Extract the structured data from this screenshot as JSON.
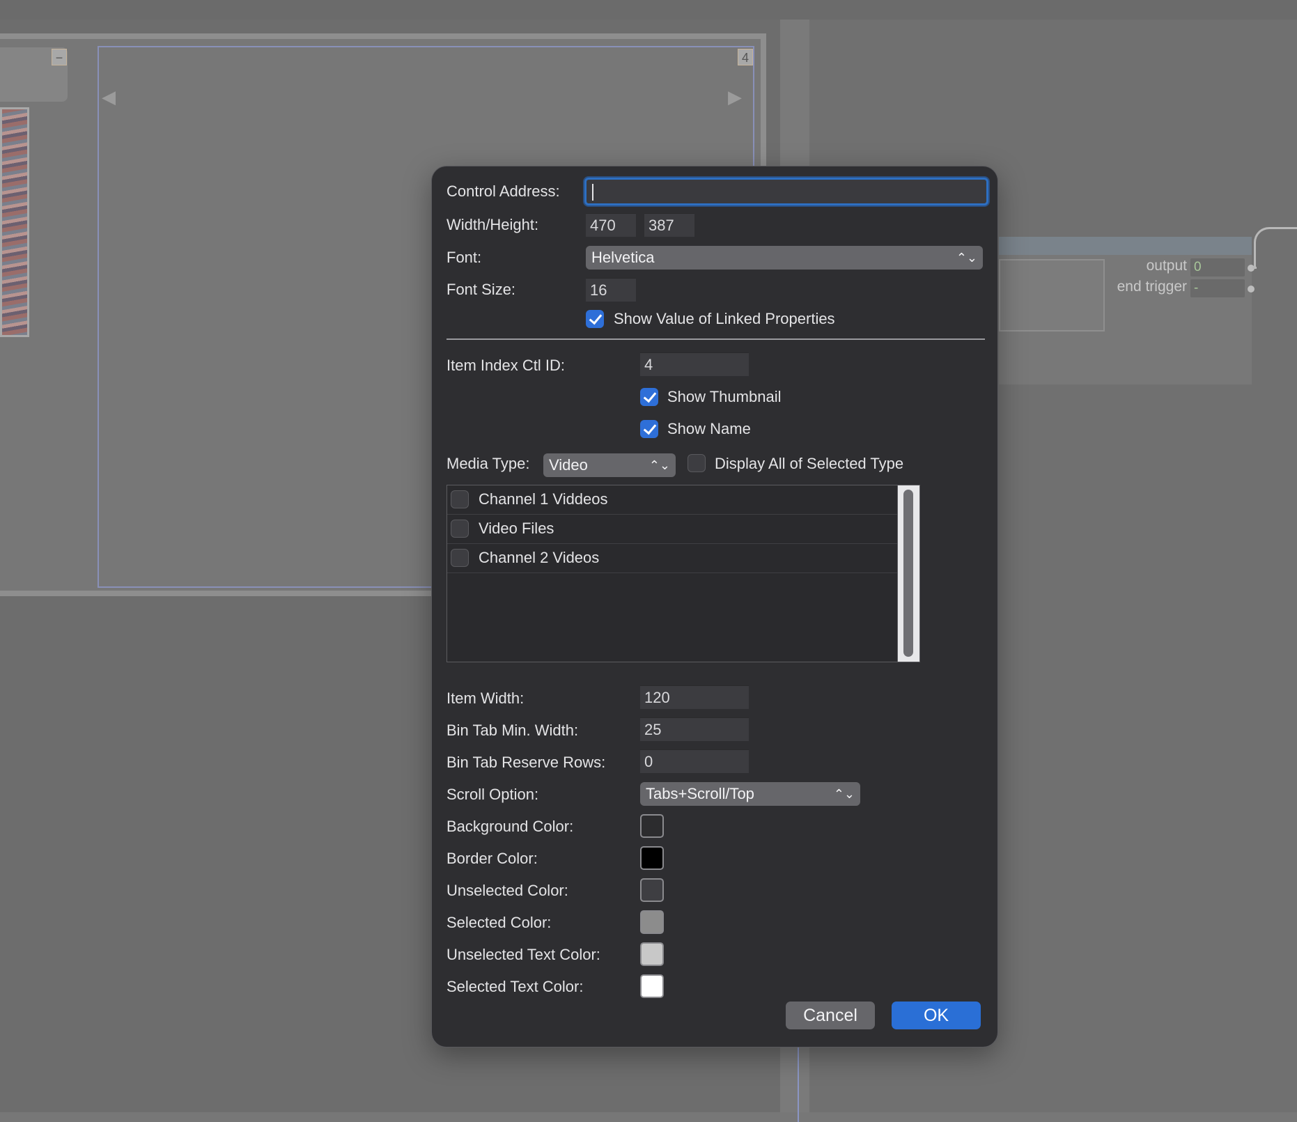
{
  "background": {
    "badge_left": "−",
    "badge_right": "4",
    "arrow_left": "◀",
    "arrow_right": "▶",
    "node": {
      "output_label": "output",
      "output_value": "0",
      "end_trigger_label": "end trigger",
      "end_trigger_value": "-"
    }
  },
  "dialog": {
    "control_address": {
      "label": "Control Address:",
      "value": ""
    },
    "width_height": {
      "label": "Width/Height:",
      "width": "470",
      "height": "387"
    },
    "font": {
      "label": "Font:",
      "value": "Helvetica"
    },
    "font_size": {
      "label": "Font Size:",
      "value": "16"
    },
    "show_value_linked": {
      "label": "Show Value of Linked Properties",
      "checked": true
    },
    "item_index": {
      "label": "Item Index Ctl ID:",
      "value": "4"
    },
    "show_thumbnail": {
      "label": "Show Thumbnail",
      "checked": true
    },
    "show_name": {
      "label": "Show Name",
      "checked": true
    },
    "media_type": {
      "label": "Media Type:",
      "value": "Video"
    },
    "display_all": {
      "label": "Display All of Selected Type",
      "checked": false
    },
    "media_list": [
      {
        "label": "Channel 1 Viddeos",
        "checked": false
      },
      {
        "label": "Video Files",
        "checked": false
      },
      {
        "label": "Channel 2 Videos",
        "checked": false
      }
    ],
    "item_width": {
      "label": "Item Width:",
      "value": "120"
    },
    "bin_tab_min_width": {
      "label": "Bin Tab Min. Width:",
      "value": "25"
    },
    "bin_tab_reserve_rows": {
      "label": "Bin Tab Reserve Rows:",
      "value": "0"
    },
    "scroll_option": {
      "label": "Scroll Option:",
      "value": "Tabs+Scroll/Top"
    },
    "colors": [
      {
        "label": "Background Color:",
        "color": "#2c2c2e"
      },
      {
        "label": "Border Color:",
        "color": "#000000"
      },
      {
        "label": "Unselected Color:",
        "color": "#3e3e42"
      },
      {
        "label": "Selected Color:",
        "color": "#8c8c8c"
      },
      {
        "label": "Unselected Text Color:",
        "color": "#c8c8c8"
      },
      {
        "label": "Selected Text Color:",
        "color": "#ffffff"
      }
    ],
    "buttons": {
      "cancel": "Cancel",
      "ok": "OK"
    }
  }
}
